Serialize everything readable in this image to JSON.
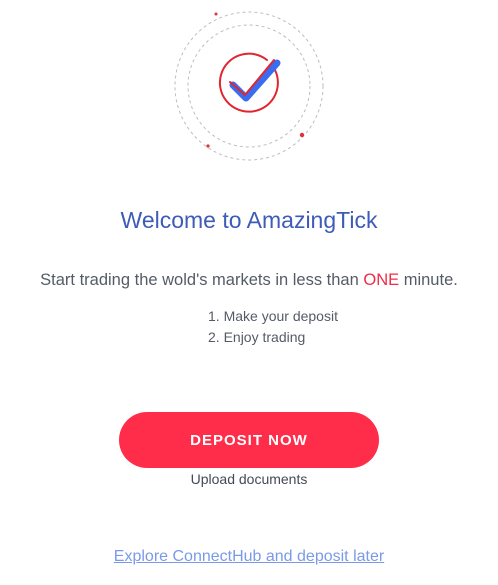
{
  "colors": {
    "title": "#3f5bb8",
    "accent": "#ff2d4a",
    "highlight": "#ef2b45",
    "link": "#7a9ae8",
    "text": "#555b66",
    "check_blue": "#3a6cf0"
  },
  "hero": {
    "icon": "check-badge-icon"
  },
  "welcome": {
    "title": "Welcome to AmazingTick",
    "subtitle_before": "Start trading the wold's markets in less than ",
    "subtitle_highlight": "ONE",
    "subtitle_after": " minute.",
    "steps": [
      "1. Make your deposit",
      "2. Enjoy trading"
    ]
  },
  "actions": {
    "deposit_label": "DEPOSIT NOW",
    "upload_label": "Upload documents",
    "explore_label": "Explore ConnectHub and deposit later"
  }
}
